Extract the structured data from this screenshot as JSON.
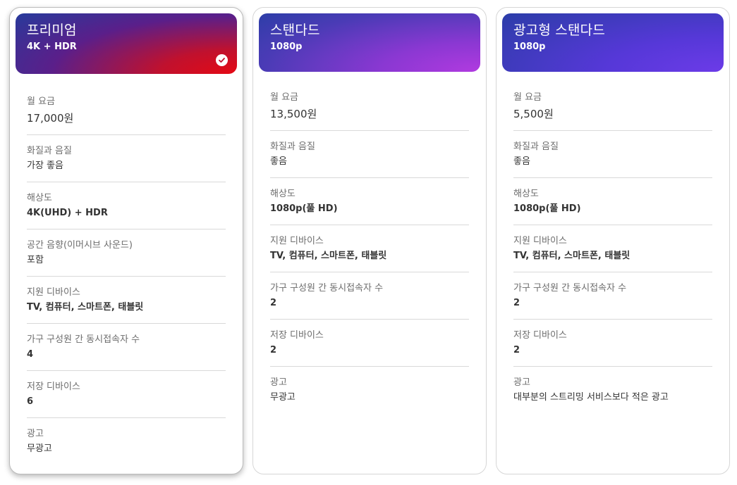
{
  "plans": [
    {
      "name": "프리미엄",
      "subtitle": "4K + HDR",
      "selected": true,
      "price_label": "월 요금",
      "price": "17,000원",
      "quality_label": "화질과 음질",
      "quality": "가장 좋음",
      "resolution_label": "해상도",
      "resolution": "4K(UHD) + HDR",
      "spatial_label": "공간 음향(이머시브 사운드)",
      "spatial": "포함",
      "devices_label": "지원 디바이스",
      "devices": "TV, 컴퓨터, 스마트폰, 태블릿",
      "streams_label": "가구 구성원 간 동시접속자 수",
      "streams": "4",
      "downloads_label": "저장 디바이스",
      "downloads": "6",
      "ads_label": "광고",
      "ads": "무광고"
    },
    {
      "name": "스탠다드",
      "subtitle": "1080p",
      "selected": false,
      "price_label": "월 요금",
      "price": "13,500원",
      "quality_label": "화질과 음질",
      "quality": "좋음",
      "resolution_label": "해상도",
      "resolution": "1080p(풀 HD)",
      "devices_label": "지원 디바이스",
      "devices": "TV, 컴퓨터, 스마트폰, 태블릿",
      "streams_label": "가구 구성원 간 동시접속자 수",
      "streams": "2",
      "downloads_label": "저장 디바이스",
      "downloads": "2",
      "ads_label": "광고",
      "ads": "무광고"
    },
    {
      "name": "광고형 스탠다드",
      "subtitle": "1080p",
      "selected": false,
      "price_label": "월 요금",
      "price": "5,500원",
      "quality_label": "화질과 음질",
      "quality": "좋음",
      "resolution_label": "해상도",
      "resolution": "1080p(풀 HD)",
      "devices_label": "지원 디바이스",
      "devices": "TV, 컴퓨터, 스마트폰, 태블릿",
      "streams_label": "가구 구성원 간 동시접속자 수",
      "streams": "2",
      "downloads_label": "저장 디바이스",
      "downloads": "2",
      "ads_label": "광고",
      "ads": "대부분의 스트리밍 서비스보다 적은 광고"
    }
  ],
  "colors": {
    "brand_red": "#e50914",
    "divider": "#d9d9d9",
    "label_gray": "#6d6d6d"
  },
  "icons": {
    "selected": "check-circle-icon"
  }
}
